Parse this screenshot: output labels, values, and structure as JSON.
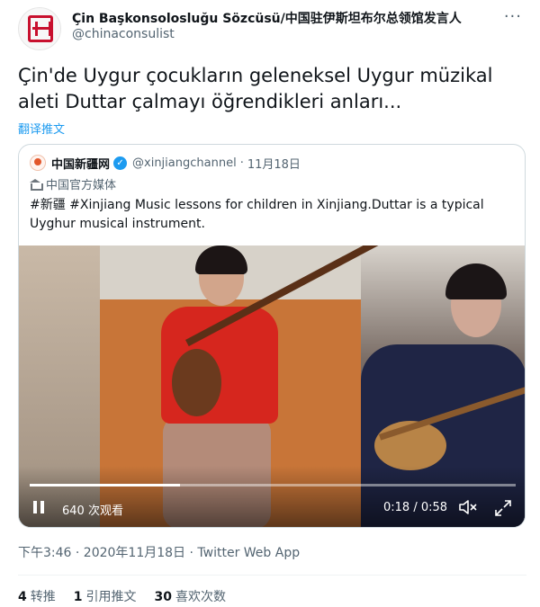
{
  "author": {
    "name": "Çin Başkonsolosluğu Sözcüsü/中国驻伊斯坦布尔总领馆发言人",
    "handle": "@chinaconsulist",
    "more_icon": "more-dots-icon"
  },
  "tweet": {
    "text": "Çin'de Uygur çocukların geleneksel Uygur müzikal aleti Duttar çalmayı öğrendikleri anları...",
    "translate_label": "翻译推文",
    "timestamp": "下午3:46 · 2020年11月18日",
    "source": "Twitter Web App"
  },
  "quote": {
    "name": "中国新疆网",
    "handle": "@xinjiangchannel",
    "separator": "·",
    "date": "11月18日",
    "label": "中国官方媒体",
    "text": "#新疆 #Xinjiang  Music lessons for children in Xinjiang.Duttar  is a typical Uyghur musical instrument.",
    "verified_icon": "verified-check-icon"
  },
  "video": {
    "views": "640 次观看",
    "time": "0:18 / 0:58",
    "progress": 0.31
  },
  "stats": {
    "retweets_count": "4",
    "retweets_label": "转推",
    "quotes_count": "1",
    "quotes_label": "引用推文",
    "likes_count": "30",
    "likes_label": "喜欢次数"
  },
  "colors": {
    "accent": "#1d9bf0",
    "text": "#0f1419",
    "secondary": "#536471"
  }
}
